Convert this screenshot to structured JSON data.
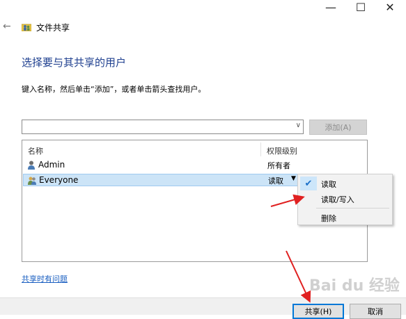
{
  "window": {
    "title": "文件共享",
    "minimize_glyph": "—",
    "maximize_glyph": "☐",
    "close_glyph": "✕",
    "back_glyph": "←"
  },
  "main": {
    "heading": "选择要与其共享的用户",
    "instruction": "键入名称，然后单击“添加”，或者单击箭头查找用户。",
    "combo_value": "",
    "add_button": "添加(A)"
  },
  "list": {
    "col_name": "名称",
    "col_permission": "权限级别",
    "rows": [
      {
        "name": "Admin",
        "permission": "所有者"
      },
      {
        "name": "Everyone",
        "permission": "读取"
      }
    ]
  },
  "context_menu": {
    "items": [
      {
        "label": "读取",
        "checked": true
      },
      {
        "label": "读取/写入",
        "checked": false
      },
      {
        "label": "删除",
        "checked": false
      }
    ]
  },
  "help_link": "共享时有问题",
  "footer": {
    "share_button": "共享(H)",
    "cancel_button": "取消"
  },
  "watermark": "Bai du 经验",
  "colors": {
    "heading": "#1e3f8f",
    "link": "#1a5fc1",
    "selection": "#cce4f7",
    "arrow": "#e02020"
  }
}
